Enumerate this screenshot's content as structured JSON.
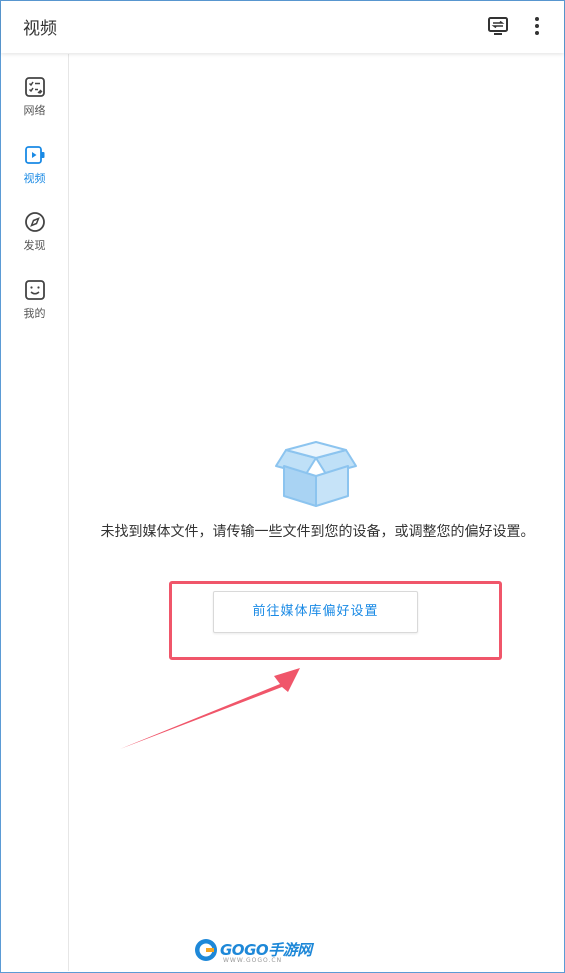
{
  "header": {
    "title": "视频",
    "icons": [
      "cast-icon",
      "more-vertical-icon"
    ]
  },
  "sidebar": {
    "items": [
      {
        "label": "网络",
        "icon": "network-list-icon",
        "active": false
      },
      {
        "label": "视频",
        "icon": "video-icon",
        "active": true
      },
      {
        "label": "发现",
        "icon": "compass-icon",
        "active": false
      },
      {
        "label": "我的",
        "icon": "smiley-face-icon",
        "active": false
      }
    ]
  },
  "main": {
    "empty_icon": "open-box-icon",
    "empty_message": "未找到媒体文件，请传输一些文件到您的设备，或调整您的偏好设置。",
    "goto_button": "前往媒体库偏好设置"
  },
  "annotation": {
    "highlight_color": "#f0566a"
  },
  "watermark": {
    "text": "GOGO手游网",
    "url": "WWW.GOGO.CN"
  },
  "colors": {
    "accent": "#1a8ae5",
    "box_icon": "#8cc4ef"
  }
}
